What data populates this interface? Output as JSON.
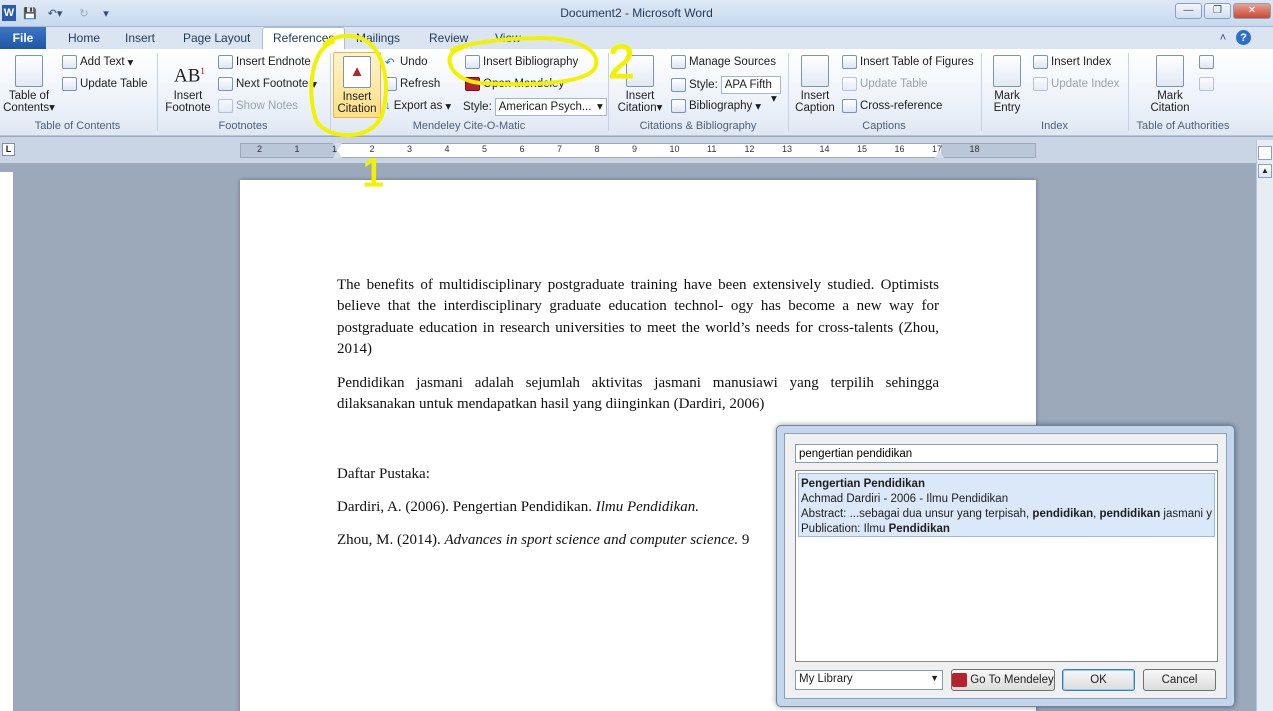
{
  "app": {
    "title": "Document2  -  Microsoft Word"
  },
  "tabs": [
    "File",
    "Home",
    "Insert",
    "Page Layout",
    "References",
    "Mailings",
    "Review",
    "View"
  ],
  "ribbon": {
    "toc": {
      "table_of_contents": "Table of\nContents",
      "add_text": "Add Text",
      "update_table": "Update Table",
      "group": "Table of Contents"
    },
    "footnotes": {
      "insert_footnote": "Insert\nFootnote",
      "insert_endnote": "Insert Endnote",
      "next_footnote": "Next Footnote",
      "show_notes": "Show Notes",
      "group": "Footnotes"
    },
    "mendeley": {
      "insert_citation": "Insert\nCitation",
      "undo": "Undo",
      "refresh": "Refresh",
      "export_as": "Export as",
      "insert_bibliography": "Insert Bibliography",
      "open_mendeley": "Open Mendeley",
      "style_label": "Style:",
      "style_value": "American Psych...",
      "group": "Mendeley Cite-O-Matic"
    },
    "citations": {
      "insert_citation": "Insert\nCitation",
      "manage_sources": "Manage Sources",
      "style_label": "Style:",
      "style_value": "APA Fifth",
      "bibliography": "Bibliography",
      "group": "Citations & Bibliography"
    },
    "captions": {
      "insert_caption": "Insert\nCaption",
      "insert_table_of_figures": "Insert Table of Figures",
      "update_table": "Update Table",
      "cross_reference": "Cross-reference",
      "group": "Captions"
    },
    "index": {
      "mark_entry": "Mark\nEntry",
      "insert_index": "Insert Index",
      "update_index": "Update Index",
      "group": "Index"
    },
    "authorities": {
      "mark_citation": "Mark\nCitation",
      "group": "Table of Authorities"
    }
  },
  "ruler": {
    "ticks": [
      "2",
      "1",
      "1",
      "2",
      "3",
      "4",
      "5",
      "6",
      "7",
      "8",
      "9",
      "10",
      "11",
      "12",
      "13",
      "14",
      "15",
      "16",
      "17",
      "18"
    ]
  },
  "document": {
    "p1": "The benefits of multidisciplinary postgraduate training have been extensively studied. Optimists believe that the interdisciplinary graduate education technol- ogy has become a new way for postgraduate education in research universities to meet the world’s needs for cross-talents (Zhou, 2014)",
    "p2": "Pendidikan jasmani adalah sejumlah aktivitas jasmani manusiawi yang terpilih sehingga dilaksanakan untuk mendapatkan hasil yang diinginkan  (Dardiri, 2006)",
    "heading": "Daftar Pustaka:",
    "ref1_plain": "Dardiri, A. (2006). Pengertian Pendidikan. ",
    "ref1_italic": "Ilmu Pendidikan.",
    "ref2_plain": "Zhou, M. (2014). ",
    "ref2_italic": "Advances in sport science and computer science.",
    "ref2_tail": " 9"
  },
  "dialog": {
    "search_value": "pengertian pendidikan",
    "result": {
      "title": "Pengertian Pendidikan",
      "authors_line": "Achmad Dardiri - 2006 - Ilmu Pendidikan",
      "abstract_prefix": "Abstract: ...sebagai dua unsur yang terpisah, ",
      "abstract_bold1": "pendidikan",
      "abstract_sep": ", ",
      "abstract_bold2": "pendidikan",
      "abstract_suffix": " jasmani y",
      "publication_prefix": "Publication: Ilmu ",
      "publication_bold": "Pendidikan"
    },
    "library": "My Library",
    "goto_button": "Go To Mendeley",
    "ok_button": "OK",
    "cancel_button": "Cancel"
  },
  "annotations": {
    "mark1": "1",
    "mark2": "2"
  },
  "colors": {
    "accent": "#1f57a8",
    "highlighter": "#f2f200"
  }
}
